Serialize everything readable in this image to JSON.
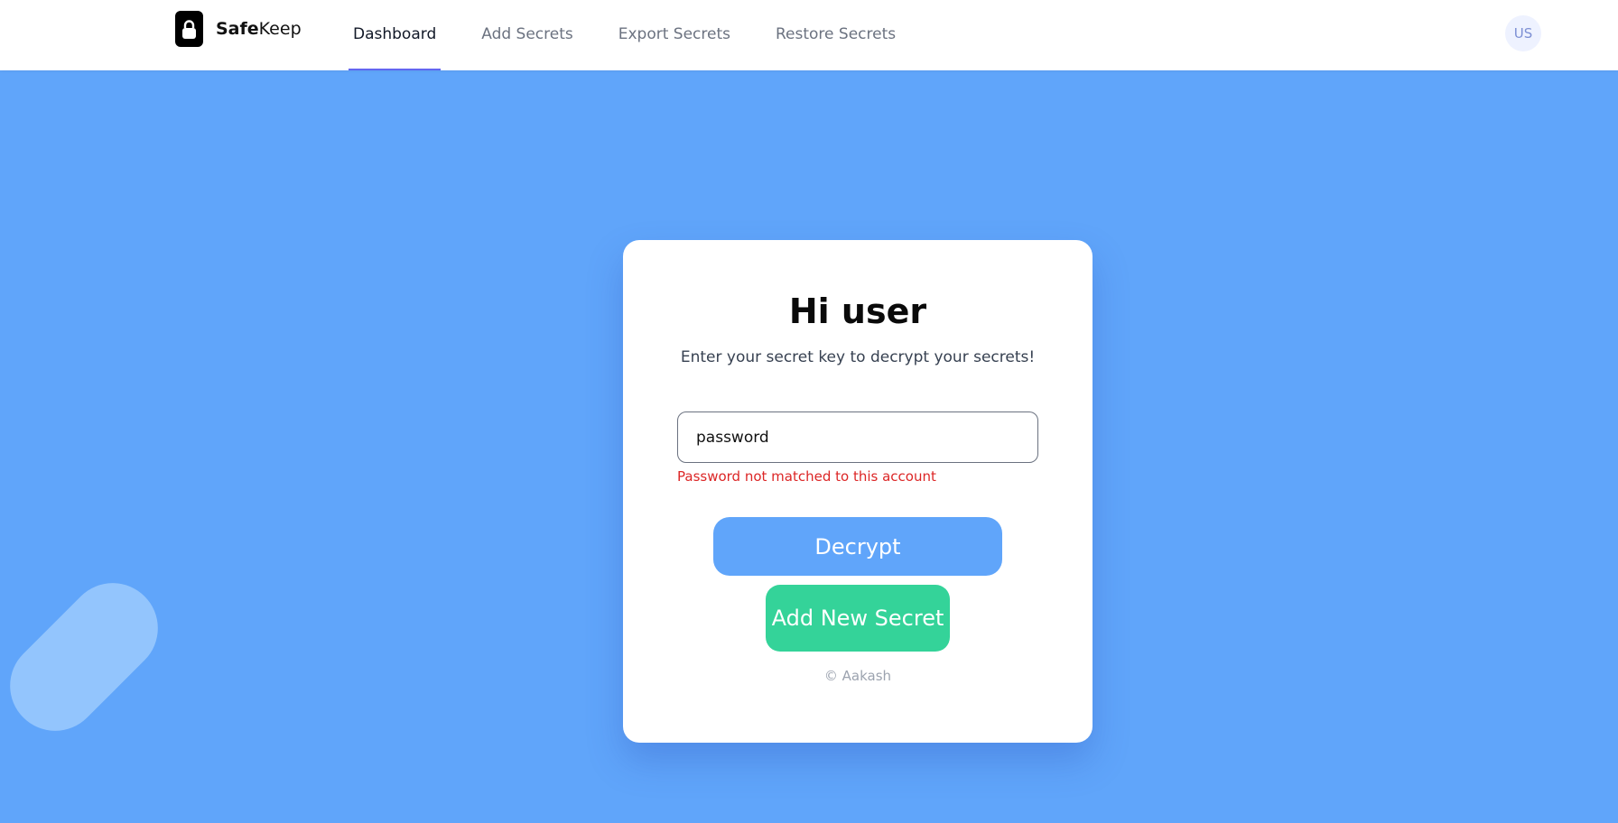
{
  "brand": {
    "name_bold": "Safe",
    "name_rest": "Keep",
    "logo_icon": "lock-icon"
  },
  "nav": {
    "items": [
      {
        "label": "Dashboard",
        "active": true
      },
      {
        "label": "Add Secrets",
        "active": false
      },
      {
        "label": "Export Secrets",
        "active": false
      },
      {
        "label": "Restore Secrets",
        "active": false
      }
    ]
  },
  "user": {
    "avatar_initials": "US"
  },
  "card": {
    "title": "Hi user",
    "subtitle": "Enter your secret key to decrypt your secrets!",
    "input_value": "password",
    "error": "Password not matched to this account",
    "decrypt_label": "Decrypt",
    "add_label": "Add New Secret",
    "copyright": "© Aakash"
  },
  "colors": {
    "background": "#60a5fa",
    "nav_active_underline": "#6366f1",
    "decrypt_button": "#60a5fa",
    "add_button": "#34d399",
    "error": "#dc2626",
    "decorative_pill": "#93c5fd"
  }
}
